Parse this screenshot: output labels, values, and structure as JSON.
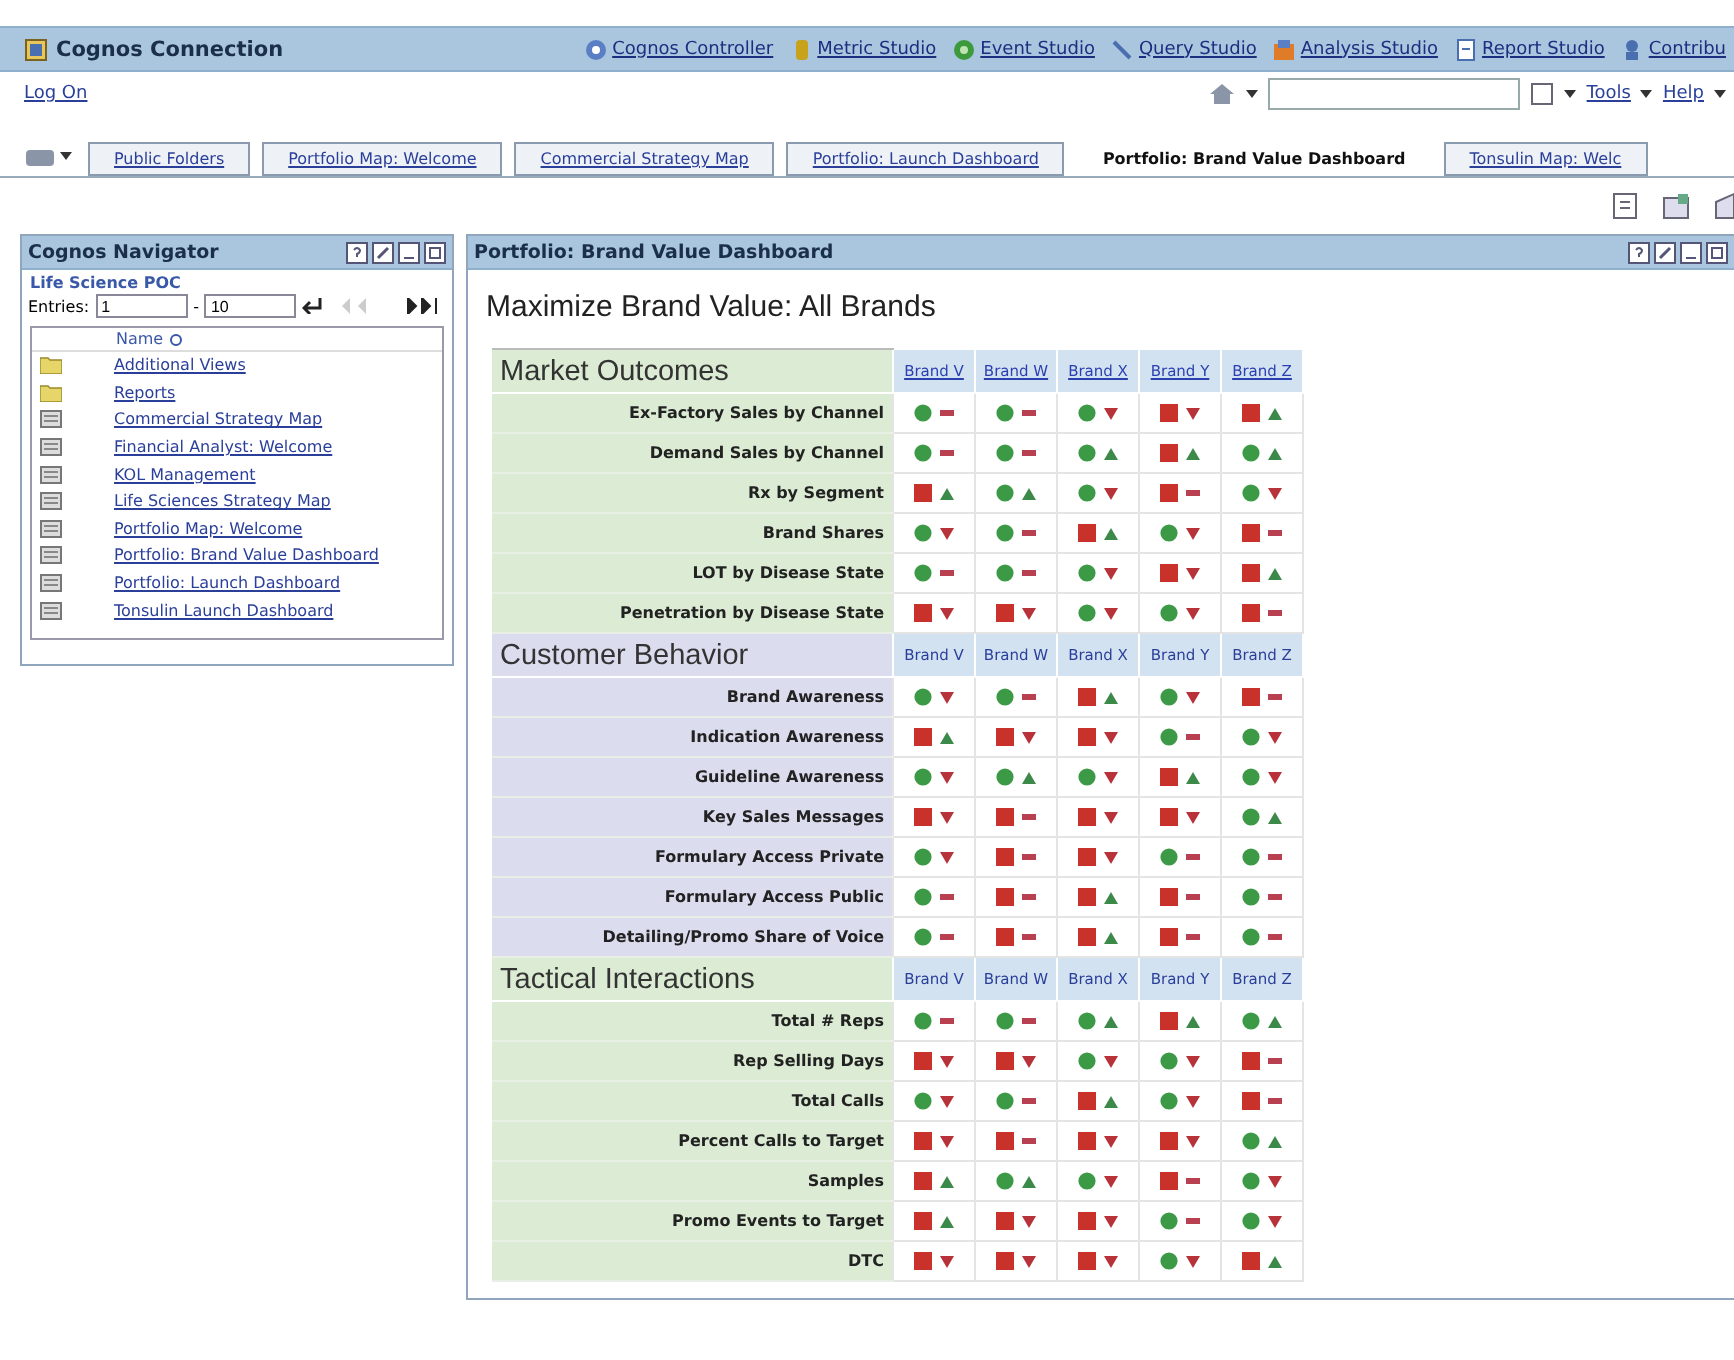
{
  "app_bar": {
    "title": "Cognos Connection",
    "studios": [
      {
        "label": "Cognos Controller",
        "kind": "controller"
      },
      {
        "label": "Metric Studio",
        "kind": "metric"
      },
      {
        "label": "Event Studio",
        "kind": "event"
      },
      {
        "label": "Query Studio",
        "kind": "query"
      },
      {
        "label": "Analysis Studio",
        "kind": "analysis"
      },
      {
        "label": "Report Studio",
        "kind": "report"
      },
      {
        "label": "Contribu",
        "kind": "contributor"
      }
    ]
  },
  "toolbar": {
    "log_on": "Log On",
    "menus": [
      "Tools",
      "Help"
    ]
  },
  "tabs": [
    {
      "label": "Public Folders",
      "selected": false
    },
    {
      "label": "Portfolio Map: Welcome",
      "selected": false
    },
    {
      "label": "Commercial Strategy Map",
      "selected": false
    },
    {
      "label": "Portfolio: Launch Dashboard",
      "selected": false
    },
    {
      "label": "Portfolio: Brand Value Dashboard",
      "selected": true
    },
    {
      "label": "Tonsulin Map: Welc",
      "selected": false
    }
  ],
  "navigator": {
    "title": "Cognos Navigator",
    "folder": "Life Science POC",
    "entries": {
      "label": "Entries:",
      "from": "1",
      "separator": "-",
      "to": "10"
    },
    "column": "Name",
    "items": [
      {
        "name": "Additional Views",
        "kind": "folder"
      },
      {
        "name": "Reports",
        "kind": "folder"
      },
      {
        "name": "Commercial Strategy Map",
        "kind": "page"
      },
      {
        "name": "Financial Analyst: Welcome",
        "kind": "page"
      },
      {
        "name": "KOL Management",
        "kind": "page"
      },
      {
        "name": "Life Sciences Strategy Map",
        "kind": "page"
      },
      {
        "name": "Portfolio Map: Welcome",
        "kind": "page"
      },
      {
        "name": "Portfolio: Brand Value Dashboard",
        "kind": "page"
      },
      {
        "name": "Portfolio: Launch Dashboard",
        "kind": "page"
      },
      {
        "name": "Tonsulin Launch Dashboard",
        "kind": "page"
      }
    ]
  },
  "dashboard": {
    "panel_title": "Portfolio: Brand Value Dashboard",
    "heading": "Maximize Brand Value: All Brands",
    "sections": [
      {
        "title": "Market Outcomes",
        "color": "#dcebd3",
        "linked": true,
        "brands": [
          "Brand V",
          "Brand W",
          "Brand X",
          "Brand Y",
          "Brand Z"
        ],
        "rows": [
          {
            "label": "Ex-Factory Sales by Channel",
            "cells": [
              {
                "on_target": true,
                "kind": "flat"
              },
              {
                "on_target": true,
                "kind": "flat"
              },
              {
                "on_target": true,
                "kind": "down"
              },
              {
                "on_target": false,
                "kind": "down"
              },
              {
                "on_target": false,
                "kind": "up"
              }
            ]
          },
          {
            "label": "Demand Sales by Channel",
            "cells": [
              {
                "on_target": true,
                "kind": "flat"
              },
              {
                "on_target": true,
                "kind": "flat"
              },
              {
                "on_target": true,
                "kind": "up"
              },
              {
                "on_target": false,
                "kind": "up"
              },
              {
                "on_target": true,
                "kind": "up"
              }
            ]
          },
          {
            "label": "Rx by Segment",
            "cells": [
              {
                "on_target": false,
                "kind": "up"
              },
              {
                "on_target": true,
                "kind": "up"
              },
              {
                "on_target": true,
                "kind": "down"
              },
              {
                "on_target": false,
                "kind": "flat"
              },
              {
                "on_target": true,
                "kind": "down"
              }
            ]
          },
          {
            "label": "Brand Shares",
            "cells": [
              {
                "on_target": true,
                "kind": "down"
              },
              {
                "on_target": true,
                "kind": "flat"
              },
              {
                "on_target": false,
                "kind": "up"
              },
              {
                "on_target": true,
                "kind": "down"
              },
              {
                "on_target": false,
                "kind": "flat"
              }
            ]
          },
          {
            "label": "LOT by Disease State",
            "cells": [
              {
                "on_target": true,
                "kind": "flat"
              },
              {
                "on_target": true,
                "kind": "flat"
              },
              {
                "on_target": true,
                "kind": "down"
              },
              {
                "on_target": false,
                "kind": "down"
              },
              {
                "on_target": false,
                "kind": "up"
              }
            ]
          },
          {
            "label": "Penetration by Disease State",
            "cells": [
              {
                "on_target": false,
                "kind": "down"
              },
              {
                "on_target": false,
                "kind": "down"
              },
              {
                "on_target": true,
                "kind": "down"
              },
              {
                "on_target": true,
                "kind": "down"
              },
              {
                "on_target": false,
                "kind": "flat"
              }
            ]
          }
        ]
      },
      {
        "title": "Customer Behavior",
        "color": "#dcdcef",
        "linked": false,
        "brands": [
          "Brand V",
          "Brand W",
          "Brand X",
          "Brand Y",
          "Brand Z"
        ],
        "rows": [
          {
            "label": "Brand Awareness",
            "cells": [
              {
                "on_target": true,
                "kind": "down"
              },
              {
                "on_target": true,
                "kind": "flat"
              },
              {
                "on_target": false,
                "kind": "up"
              },
              {
                "on_target": true,
                "kind": "down"
              },
              {
                "on_target": false,
                "kind": "flat"
              }
            ]
          },
          {
            "label": "Indication Awareness",
            "cells": [
              {
                "on_target": false,
                "kind": "up"
              },
              {
                "on_target": false,
                "kind": "down"
              },
              {
                "on_target": false,
                "kind": "down"
              },
              {
                "on_target": true,
                "kind": "flat"
              },
              {
                "on_target": true,
                "kind": "down"
              }
            ]
          },
          {
            "label": "Guideline Awareness",
            "cells": [
              {
                "on_target": true,
                "kind": "down"
              },
              {
                "on_target": true,
                "kind": "up"
              },
              {
                "on_target": true,
                "kind": "down"
              },
              {
                "on_target": false,
                "kind": "up"
              },
              {
                "on_target": true,
                "kind": "down"
              }
            ]
          },
          {
            "label": "Key Sales Messages",
            "cells": [
              {
                "on_target": false,
                "kind": "down"
              },
              {
                "on_target": false,
                "kind": "flat"
              },
              {
                "on_target": false,
                "kind": "down"
              },
              {
                "on_target": false,
                "kind": "down"
              },
              {
                "on_target": true,
                "kind": "up"
              }
            ]
          },
          {
            "label": "Formulary Access Private",
            "cells": [
              {
                "on_target": true,
                "kind": "down"
              },
              {
                "on_target": false,
                "kind": "flat"
              },
              {
                "on_target": false,
                "kind": "down"
              },
              {
                "on_target": true,
                "kind": "flat"
              },
              {
                "on_target": true,
                "kind": "flat"
              }
            ]
          },
          {
            "label": "Formulary Access Public",
            "cells": [
              {
                "on_target": true,
                "kind": "flat"
              },
              {
                "on_target": false,
                "kind": "flat"
              },
              {
                "on_target": false,
                "kind": "up"
              },
              {
                "on_target": false,
                "kind": "flat"
              },
              {
                "on_target": true,
                "kind": "flat"
              }
            ]
          },
          {
            "label": "Detailing/Promo Share of Voice",
            "cells": [
              {
                "on_target": true,
                "kind": "flat"
              },
              {
                "on_target": false,
                "kind": "flat"
              },
              {
                "on_target": false,
                "kind": "up"
              },
              {
                "on_target": false,
                "kind": "flat"
              },
              {
                "on_target": true,
                "kind": "flat"
              }
            ]
          }
        ]
      },
      {
        "title": "Tactical Interactions",
        "color": "#dcebd3",
        "linked": false,
        "brands": [
          "Brand V",
          "Brand W",
          "Brand X",
          "Brand Y",
          "Brand Z"
        ],
        "rows": [
          {
            "label": "Total # Reps",
            "cells": [
              {
                "on_target": true,
                "kind": "flat"
              },
              {
                "on_target": true,
                "kind": "flat"
              },
              {
                "on_target": true,
                "kind": "up"
              },
              {
                "on_target": false,
                "kind": "up"
              },
              {
                "on_target": true,
                "kind": "up"
              }
            ]
          },
          {
            "label": "Rep Selling Days",
            "cells": [
              {
                "on_target": false,
                "kind": "down"
              },
              {
                "on_target": false,
                "kind": "down"
              },
              {
                "on_target": true,
                "kind": "down"
              },
              {
                "on_target": true,
                "kind": "down"
              },
              {
                "on_target": false,
                "kind": "flat"
              }
            ]
          },
          {
            "label": "Total Calls",
            "cells": [
              {
                "on_target": true,
                "kind": "down"
              },
              {
                "on_target": true,
                "kind": "flat"
              },
              {
                "on_target": false,
                "kind": "up"
              },
              {
                "on_target": true,
                "kind": "down"
              },
              {
                "on_target": false,
                "kind": "flat"
              }
            ]
          },
          {
            "label": "Percent Calls to Target",
            "cells": [
              {
                "on_target": false,
                "kind": "down"
              },
              {
                "on_target": false,
                "kind": "flat"
              },
              {
                "on_target": false,
                "kind": "down"
              },
              {
                "on_target": false,
                "kind": "down"
              },
              {
                "on_target": true,
                "kind": "up"
              }
            ]
          },
          {
            "label": "Samples",
            "cells": [
              {
                "on_target": false,
                "kind": "up"
              },
              {
                "on_target": true,
                "kind": "up"
              },
              {
                "on_target": true,
                "kind": "down"
              },
              {
                "on_target": false,
                "kind": "flat"
              },
              {
                "on_target": true,
                "kind": "down"
              }
            ]
          },
          {
            "label": "Promo Events to Target",
            "cells": [
              {
                "on_target": false,
                "kind": "up"
              },
              {
                "on_target": false,
                "kind": "down"
              },
              {
                "on_target": false,
                "kind": "down"
              },
              {
                "on_target": true,
                "kind": "flat"
              },
              {
                "on_target": true,
                "kind": "down"
              }
            ]
          },
          {
            "label": "DTC",
            "cells": [
              {
                "on_target": false,
                "kind": "down"
              },
              {
                "on_target": false,
                "kind": "down"
              },
              {
                "on_target": false,
                "kind": "down"
              },
              {
                "on_target": true,
                "kind": "down"
              },
              {
                "on_target": false,
                "kind": "up"
              }
            ]
          }
        ]
      }
    ]
  }
}
